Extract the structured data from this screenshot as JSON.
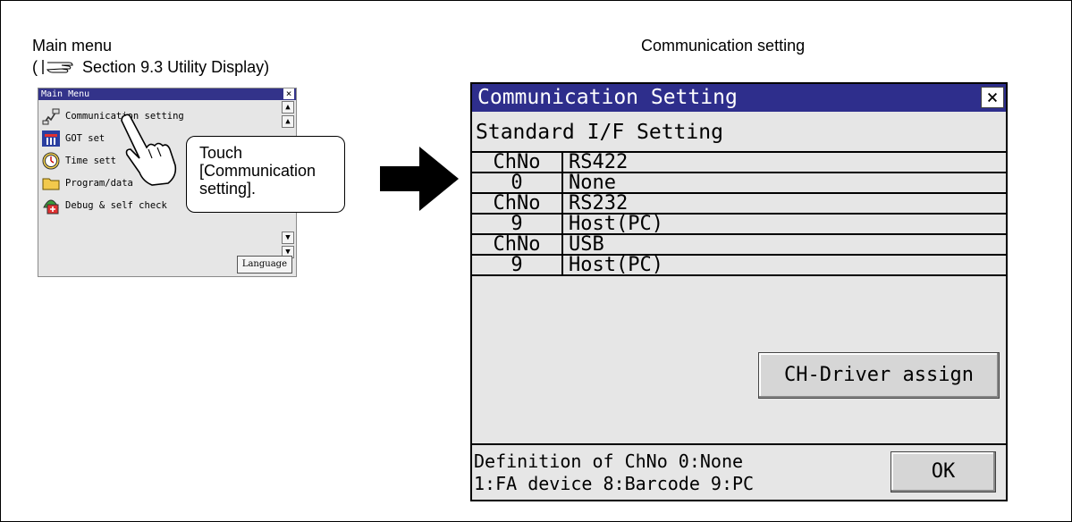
{
  "captions": {
    "main_menu": "Main menu",
    "ref_open": "(",
    "ref_text": "Section 9.3 Utility Display)",
    "comm_setting": "Communication setting"
  },
  "main_menu": {
    "title": "Main Menu",
    "close": "×",
    "items": [
      {
        "label": "Communication setting",
        "icon": "communication-icon"
      },
      {
        "label": "GOT set",
        "icon": "got-set-icon"
      },
      {
        "label": "Time sett",
        "icon": "clock-icon"
      },
      {
        "label": "Program/data",
        "icon": "folder-icon"
      },
      {
        "label": "Debug & self check",
        "icon": "debug-icon"
      }
    ],
    "language_button": "Language"
  },
  "callout": {
    "line1": "Touch",
    "line2": "[Communication",
    "line3": "setting]."
  },
  "comm_panel": {
    "title": "Communication Setting",
    "close": "×",
    "section": "Standard I/F Setting",
    "rows": [
      {
        "c1": "ChNo",
        "c2": "RS422"
      },
      {
        "c1": "0",
        "c2": "None"
      },
      {
        "c1": "ChNo",
        "c2": "RS232"
      },
      {
        "c1": "9",
        "c2": "Host(PC)"
      },
      {
        "c1": "ChNo",
        "c2": "USB"
      },
      {
        "c1": "9",
        "c2": "Host(PC)"
      }
    ],
    "ch_driver_button": "CH-Driver assign",
    "footer_line1": "Definition of ChNo  0:None",
    "footer_line2": "1:FA device 8:Barcode 9:PC",
    "ok_button": "OK"
  },
  "colors": {
    "title_bar": "#2e2e8c",
    "panel_bg": "#e6e6e6",
    "button_bg": "#d6d6d6"
  }
}
